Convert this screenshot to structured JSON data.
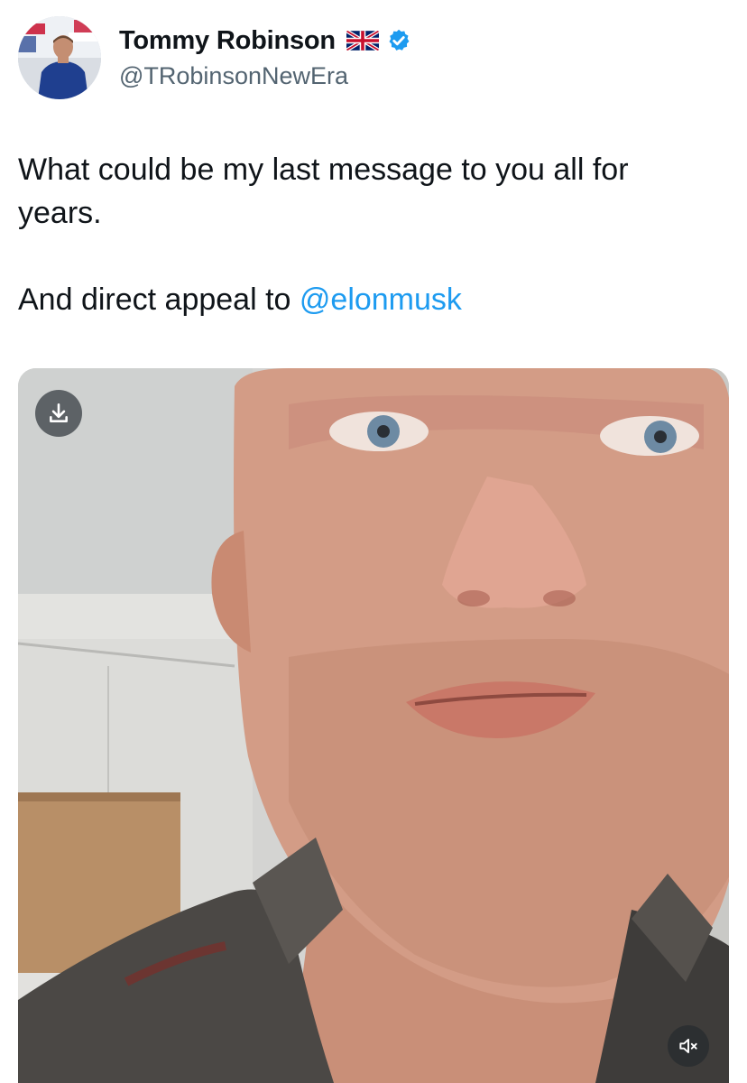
{
  "author": {
    "name": "Tommy Robinson",
    "handle": "@TRobinsonNewEra",
    "flag_icon": "uk-flag-icon",
    "verified_icon": "verified-badge-icon",
    "verified_color": "#1d9bf0"
  },
  "tweet": {
    "line1": "What could be my last message to you all for",
    "line2": "years.",
    "line3_prefix": "And direct appeal to ",
    "mention": "@elonmusk",
    "mention_color": "#1d9bf0"
  },
  "media": {
    "type": "video",
    "download_icon": "download-icon",
    "mute_icon": "speaker-muted-icon"
  }
}
